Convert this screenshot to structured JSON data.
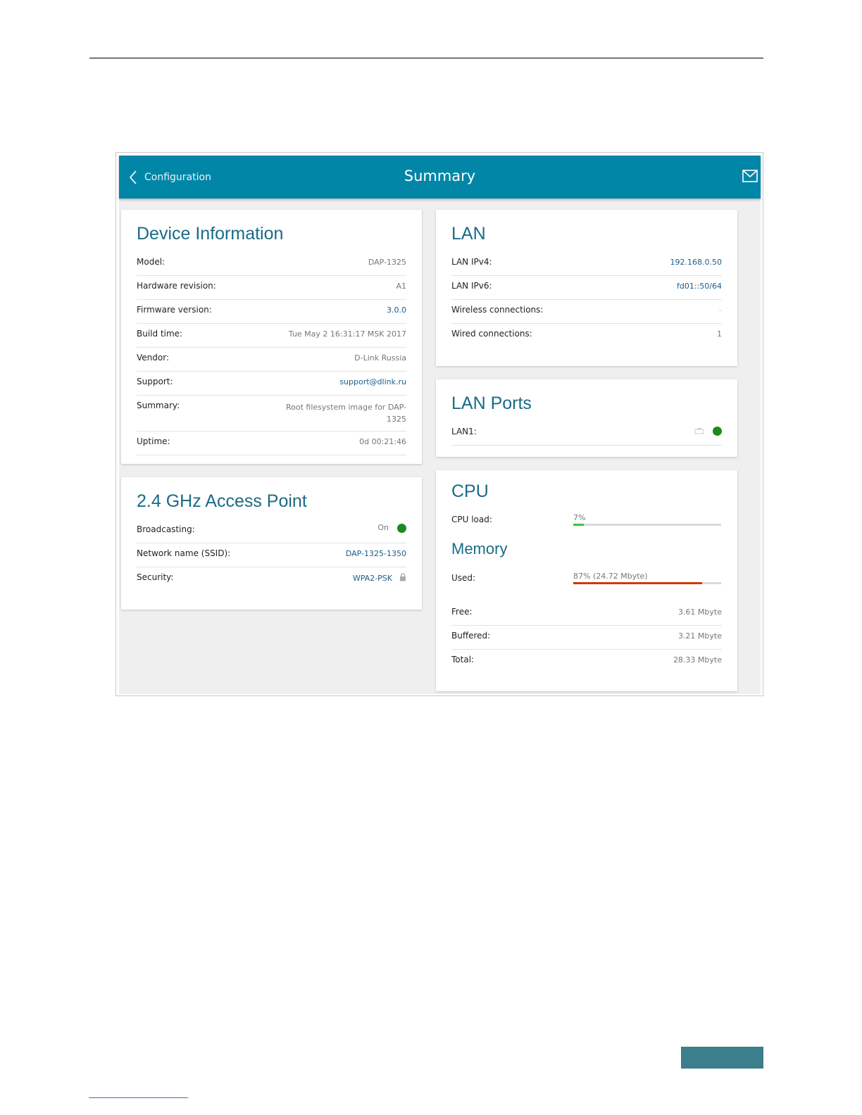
{
  "header": {
    "back_label": "Configuration",
    "title": "Summary",
    "back_icon": "chevron-left-icon",
    "mail_icon": "envelope-icon"
  },
  "device_info": {
    "title": "Device Information",
    "rows": [
      {
        "label": "Model:",
        "value": "DAP-1325"
      },
      {
        "label": "Hardware revision:",
        "value": "A1"
      },
      {
        "label": "Firmware version:",
        "value": "3.0.0"
      },
      {
        "label": "Build time:",
        "value": "Tue May 2 16:31:17 MSK 2017"
      },
      {
        "label": "Vendor:",
        "value": "D-Link Russia"
      },
      {
        "label": "Support:",
        "value": "support@dlink.ru"
      },
      {
        "label": "Summary:",
        "value": "Root filesystem image for DAP-1325"
      },
      {
        "label": "Uptime:",
        "value": "0d 00:21:46"
      }
    ]
  },
  "access_point": {
    "title": "2.4 GHz Access Point",
    "broadcasting": {
      "label": "Broadcasting:",
      "value": "On",
      "status_color": "#1c8a1c"
    },
    "ssid": {
      "label": "Network name (SSID):",
      "value": "DAP-1325-1350"
    },
    "security": {
      "label": "Security:",
      "value": "WPA2-PSK",
      "icon": "lock-icon"
    }
  },
  "lan": {
    "title": "LAN",
    "rows": [
      {
        "label": "LAN IPv4:",
        "value": "192.168.0.50"
      },
      {
        "label": "LAN IPv6:",
        "value": "fd01::50/64"
      },
      {
        "label": "Wireless connections:",
        "value": "-"
      },
      {
        "label": "Wired connections:",
        "value": "1"
      }
    ]
  },
  "lan_ports": {
    "title": "LAN Ports",
    "port": {
      "label": "LAN1:",
      "icon": "ethernet-port-icon",
      "status_color": "#1c8a1c"
    }
  },
  "cpu": {
    "title": "CPU",
    "load_label": "CPU load:",
    "load_text": "7%",
    "load_fraction": 0.07,
    "bar_color": "#3cc43c"
  },
  "memory": {
    "title": "Memory",
    "used_label": "Used:",
    "used_text": "87% (24.72 Mbyte)",
    "used_fraction": 0.87,
    "bar_color": "#cc3a0f",
    "rows": [
      {
        "label": "Free:",
        "value": "3.61 Mbyte"
      },
      {
        "label": "Buffered:",
        "value": "3.21 Mbyte"
      },
      {
        "label": "Total:",
        "value": "28.33 Mbyte"
      }
    ]
  },
  "colors": {
    "header_bg": "#0286a8",
    "title_color": "#1a6b87",
    "link_color": "#1b5c8a"
  }
}
